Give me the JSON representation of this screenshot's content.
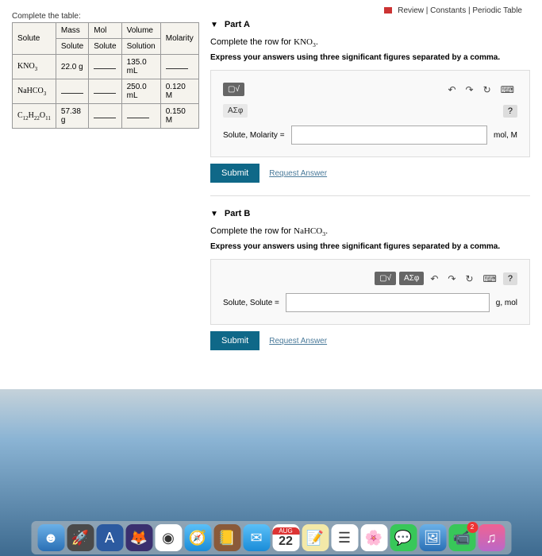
{
  "topLinks": {
    "review": "Review",
    "constants": "Constants",
    "periodic": "Periodic Table"
  },
  "table": {
    "title": "Complete the table:",
    "headers": {
      "c1": "Solute",
      "c2": "Mass Solute",
      "c3": "Mol Solute",
      "c4": "Volume Solution",
      "c5": "Molarity"
    },
    "rows": [
      {
        "solute": "KNO₃",
        "mass": "22.0 g",
        "mol": "",
        "vol": "135.0 mL",
        "molar": ""
      },
      {
        "solute": "NaHCO₃",
        "mass": "",
        "mol": "",
        "vol": "250.0 mL",
        "molar": "0.120 M"
      },
      {
        "solute": "C₁₂H₂₂O₁₁",
        "mass": "57.38 g",
        "mol": "",
        "vol": "",
        "molar": "0.150 M"
      }
    ]
  },
  "partA": {
    "title": "Part A",
    "instruction": "Complete the row for KNO₃.",
    "bold": "Express your answers using three significant figures separated by a comma.",
    "label": "Solute, Molarity =",
    "unit": "mol, M",
    "toolbar": {
      "symbols": "ΑΣφ"
    }
  },
  "partB": {
    "title": "Part B",
    "instruction": "Complete the row for NaHCO₃.",
    "bold": "Express your answers using three significant figures separated by a comma.",
    "label": "Solute, Solute =",
    "unit": "g, mol",
    "toolbar": {
      "symbols": "ΑΣφ"
    }
  },
  "buttons": {
    "submit": "Submit",
    "request": "Request Answer"
  },
  "help": "?",
  "dock": {
    "calendarDay": "22",
    "badge": "2"
  }
}
